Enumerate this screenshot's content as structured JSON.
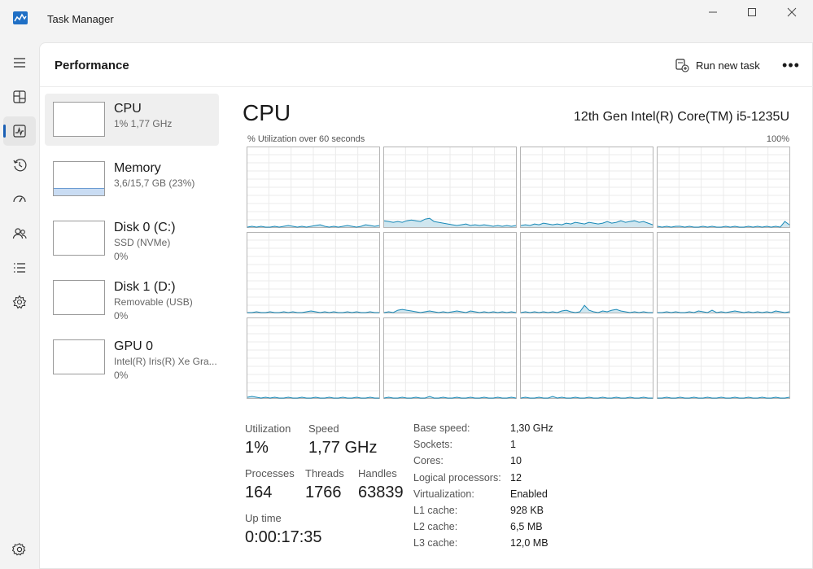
{
  "window": {
    "title": "Task Manager",
    "icons": [
      "task-manager-app-icon",
      "minimize-icon",
      "maximize-icon",
      "close-icon"
    ]
  },
  "nav": {
    "items": [
      "hamburger-menu-icon",
      "processes-icon",
      "performance-icon",
      "app-history-icon",
      "startup-apps-icon",
      "users-icon",
      "details-icon",
      "services-icon",
      "settings-icon"
    ],
    "active": "performance-icon"
  },
  "header": {
    "title": "Performance",
    "run_new_task": "Run new task",
    "more": "•••"
  },
  "resources": [
    {
      "name": "CPU",
      "line1": "1% 1,77 GHz",
      "line2": "",
      "fill_percent": 1
    },
    {
      "name": "Memory",
      "line1": "3,6/15,7 GB (23%)",
      "line2": "",
      "fill_percent": 23
    },
    {
      "name": "Disk 0 (C:)",
      "line1": "SSD (NVMe)",
      "line2": "0%",
      "fill_percent": 0
    },
    {
      "name": "Disk 1 (D:)",
      "line1": "Removable (USB)",
      "line2": "0%",
      "fill_percent": 0
    },
    {
      "name": "GPU 0",
      "line1": "Intel(R) Iris(R) Xe Gra...",
      "line2": "0%",
      "fill_percent": 0
    }
  ],
  "cpu": {
    "title": "CPU",
    "model": "12th Gen Intel(R) Core(TM) i5-1235U",
    "util_label": "% Utilization over 60 seconds",
    "util_max": "100%",
    "accent": "#1989b7",
    "fill": "#cfe6ef",
    "cores": [
      [
        0,
        1,
        0,
        1,
        0,
        0,
        1,
        0,
        1,
        2,
        1,
        0,
        1,
        0,
        1,
        2,
        3,
        1,
        0,
        1,
        0,
        1,
        2,
        1,
        0,
        1,
        3,
        2,
        1,
        2
      ],
      [
        8,
        7,
        6,
        7,
        6,
        8,
        9,
        8,
        7,
        10,
        11,
        7,
        6,
        5,
        4,
        3,
        2,
        3,
        4,
        2,
        3,
        2,
        3,
        2,
        1,
        2,
        1,
        2,
        1,
        2
      ],
      [
        2,
        3,
        2,
        4,
        3,
        5,
        4,
        3,
        4,
        3,
        5,
        4,
        6,
        5,
        4,
        6,
        5,
        4,
        5,
        7,
        5,
        6,
        8,
        6,
        7,
        8,
        6,
        7,
        5,
        3
      ],
      [
        1,
        0,
        1,
        0,
        1,
        1,
        0,
        1,
        0,
        0,
        1,
        0,
        1,
        0,
        0,
        1,
        0,
        1,
        0,
        0,
        1,
        0,
        1,
        0,
        1,
        0,
        1,
        0,
        7,
        3
      ],
      [
        0,
        0,
        1,
        0,
        0,
        1,
        0,
        0,
        1,
        0,
        1,
        0,
        0,
        1,
        2,
        1,
        0,
        1,
        0,
        1,
        0,
        0,
        1,
        0,
        1,
        0,
        0,
        1,
        0,
        0
      ],
      [
        0,
        1,
        0,
        3,
        4,
        3,
        2,
        1,
        0,
        1,
        2,
        1,
        0,
        1,
        0,
        1,
        2,
        1,
        0,
        2,
        1,
        0,
        1,
        0,
        1,
        0,
        1,
        0,
        1,
        0
      ],
      [
        0,
        1,
        0,
        1,
        0,
        1,
        0,
        1,
        0,
        2,
        3,
        1,
        0,
        1,
        9,
        3,
        1,
        0,
        2,
        1,
        3,
        4,
        2,
        1,
        0,
        1,
        0,
        1,
        0,
        0
      ],
      [
        0,
        0,
        1,
        0,
        1,
        0,
        0,
        1,
        0,
        2,
        1,
        0,
        3,
        0,
        1,
        0,
        1,
        2,
        1,
        0,
        1,
        0,
        1,
        0,
        1,
        0,
        2,
        1,
        0,
        1
      ],
      [
        1,
        2,
        1,
        0,
        1,
        0,
        1,
        0,
        0,
        1,
        0,
        0,
        1,
        0,
        0,
        1,
        0,
        0,
        1,
        0,
        0,
        1,
        0,
        0,
        1,
        0,
        0,
        1,
        0,
        0
      ],
      [
        0,
        1,
        0,
        0,
        1,
        0,
        0,
        1,
        0,
        0,
        2,
        0,
        0,
        1,
        0,
        0,
        1,
        0,
        0,
        1,
        0,
        0,
        1,
        0,
        0,
        1,
        0,
        0,
        1,
        0
      ],
      [
        0,
        1,
        0,
        0,
        1,
        0,
        0,
        2,
        0,
        1,
        0,
        0,
        1,
        0,
        0,
        1,
        0,
        0,
        1,
        0,
        0,
        1,
        0,
        0,
        1,
        0,
        0,
        1,
        0,
        0
      ],
      [
        0,
        0,
        1,
        0,
        0,
        1,
        0,
        0,
        1,
        0,
        0,
        1,
        0,
        0,
        1,
        0,
        0,
        1,
        0,
        0,
        1,
        0,
        0,
        1,
        0,
        0,
        1,
        0,
        0,
        1
      ]
    ]
  },
  "stats": {
    "utilization_label": "Utilization",
    "utilization": "1%",
    "speed_label": "Speed",
    "speed": "1,77 GHz",
    "processes_label": "Processes",
    "processes": "164",
    "threads_label": "Threads",
    "threads": "1766",
    "handles_label": "Handles",
    "handles": "63839",
    "uptime_label": "Up time",
    "uptime": "0:00:17:35"
  },
  "specs": [
    {
      "label": "Base speed:",
      "value": "1,30 GHz"
    },
    {
      "label": "Sockets:",
      "value": "1"
    },
    {
      "label": "Cores:",
      "value": "10"
    },
    {
      "label": "Logical processors:",
      "value": "12"
    },
    {
      "label": "Virtualization:",
      "value": "Enabled"
    },
    {
      "label": "L1 cache:",
      "value": "928 KB"
    },
    {
      "label": "L2 cache:",
      "value": "6,5 MB"
    },
    {
      "label": "L3 cache:",
      "value": "12,0 MB"
    }
  ]
}
